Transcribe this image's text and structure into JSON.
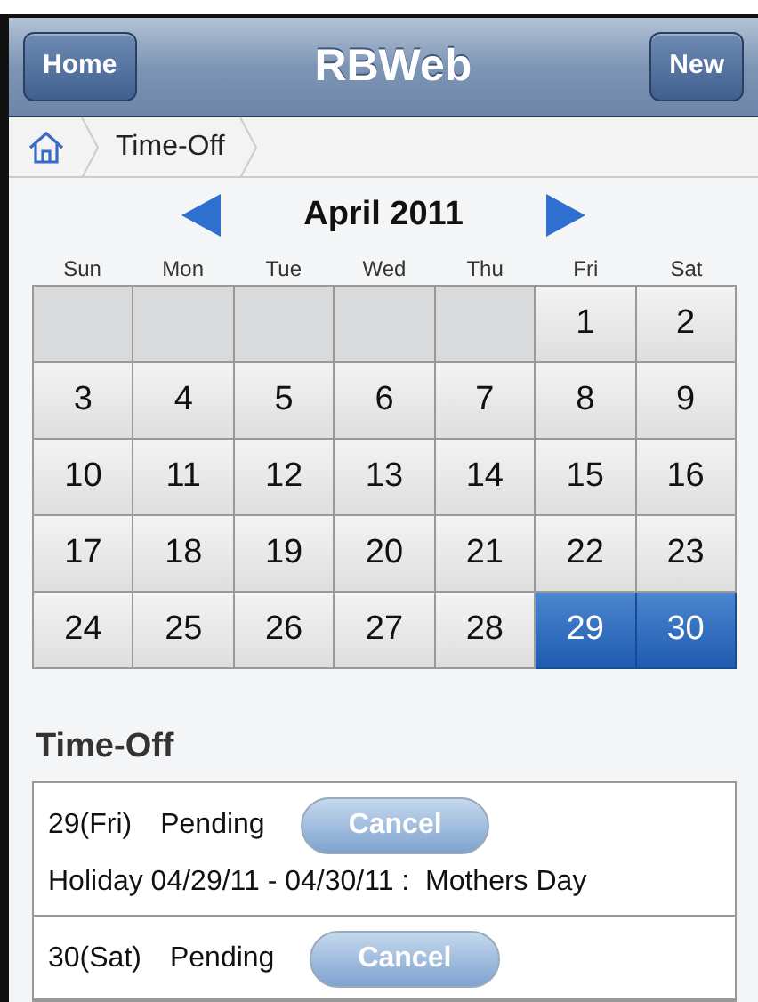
{
  "header": {
    "left_button": "Home",
    "title": "RBWeb",
    "right_button": "New"
  },
  "breadcrumb": {
    "items": [
      "Time-Off"
    ]
  },
  "calendar": {
    "month": "April 2011",
    "weekdays": [
      "Sun",
      "Mon",
      "Tue",
      "Wed",
      "Thu",
      "Fri",
      "Sat"
    ],
    "weeks": [
      [
        {
          "kind": "blank"
        },
        {
          "kind": "blank"
        },
        {
          "kind": "blank"
        },
        {
          "kind": "blank"
        },
        {
          "kind": "blank"
        },
        {
          "kind": "day",
          "label": "1",
          "selected": false
        },
        {
          "kind": "day",
          "label": "2",
          "selected": false
        }
      ],
      [
        {
          "kind": "day",
          "label": "3",
          "selected": false
        },
        {
          "kind": "day",
          "label": "4",
          "selected": false
        },
        {
          "kind": "day",
          "label": "5",
          "selected": false
        },
        {
          "kind": "day",
          "label": "6",
          "selected": false
        },
        {
          "kind": "day",
          "label": "7",
          "selected": false
        },
        {
          "kind": "day",
          "label": "8",
          "selected": false
        },
        {
          "kind": "day",
          "label": "9",
          "selected": false
        }
      ],
      [
        {
          "kind": "day",
          "label": "10",
          "selected": false
        },
        {
          "kind": "day",
          "label": "11",
          "selected": false
        },
        {
          "kind": "day",
          "label": "12",
          "selected": false
        },
        {
          "kind": "day",
          "label": "13",
          "selected": false
        },
        {
          "kind": "day",
          "label": "14",
          "selected": false
        },
        {
          "kind": "day",
          "label": "15",
          "selected": false
        },
        {
          "kind": "day",
          "label": "16",
          "selected": false
        }
      ],
      [
        {
          "kind": "day",
          "label": "17",
          "selected": false
        },
        {
          "kind": "day",
          "label": "18",
          "selected": false
        },
        {
          "kind": "day",
          "label": "19",
          "selected": false
        },
        {
          "kind": "day",
          "label": "20",
          "selected": false
        },
        {
          "kind": "day",
          "label": "21",
          "selected": false
        },
        {
          "kind": "day",
          "label": "22",
          "selected": false
        },
        {
          "kind": "day",
          "label": "23",
          "selected": false
        }
      ],
      [
        {
          "kind": "day",
          "label": "24",
          "selected": false
        },
        {
          "kind": "day",
          "label": "25",
          "selected": false
        },
        {
          "kind": "day",
          "label": "26",
          "selected": false
        },
        {
          "kind": "day",
          "label": "27",
          "selected": false
        },
        {
          "kind": "day",
          "label": "28",
          "selected": false
        },
        {
          "kind": "day",
          "label": "29",
          "selected": true
        },
        {
          "kind": "day",
          "label": "30",
          "selected": true
        }
      ]
    ]
  },
  "time_off": {
    "title": "Time-Off",
    "entries": [
      {
        "day": "29(Fri)",
        "status": "Pending",
        "button": "Cancel",
        "detail": "Holiday 04/29/11 - 04/30/11 :  Mothers Day"
      },
      {
        "day": "30(Sat)",
        "status": "Pending",
        "button": "Cancel"
      }
    ]
  }
}
